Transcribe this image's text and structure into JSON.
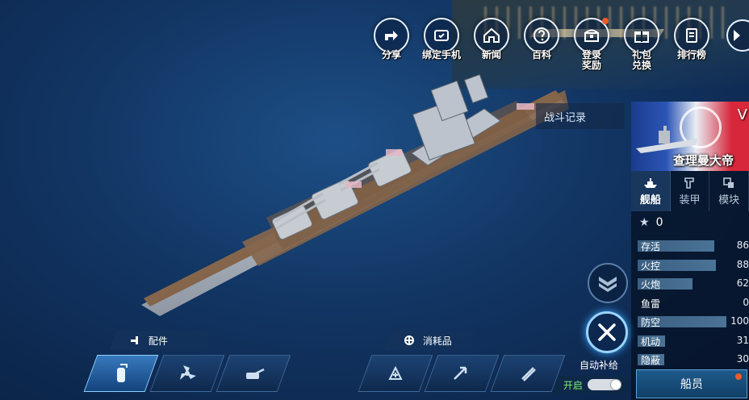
{
  "top_menu": [
    {
      "label": "分享",
      "icon": "share-icon",
      "dot": false
    },
    {
      "label": "绑定手机",
      "icon": "phone-bind-icon",
      "dot": false
    },
    {
      "label": "新闻",
      "icon": "home-icon",
      "dot": false
    },
    {
      "label": "百科",
      "icon": "help-icon",
      "dot": false
    },
    {
      "label": "登录\n奖励",
      "icon": "chest-icon",
      "dot": true
    },
    {
      "label": "礼包\n兑换",
      "icon": "gift-icon",
      "dot": false
    },
    {
      "label": "排行榜",
      "icon": "leaderboard-icon",
      "dot": false
    }
  ],
  "battle_log": "战斗记录",
  "ship": {
    "tier": "V",
    "name": "查理曼大帝"
  },
  "tabs": [
    {
      "label": "舰船",
      "icon": "ship-icon",
      "active": true
    },
    {
      "label": "装甲",
      "icon": "armor-icon",
      "active": false
    },
    {
      "label": "模块",
      "icon": "module-icon",
      "active": false
    }
  ],
  "stars": "0",
  "stats": [
    {
      "name": "存活",
      "value": 86,
      "level": 0.86
    },
    {
      "name": "火控",
      "value": 88,
      "level": 0.88
    },
    {
      "name": "火炮",
      "value": 62,
      "level": 0.62
    },
    {
      "name": "鱼雷",
      "value": 0,
      "level": 0
    },
    {
      "name": "防空",
      "value": 100,
      "level": 1.0
    },
    {
      "name": "机动",
      "value": 31,
      "level": 0.31
    },
    {
      "name": "隐蔽",
      "value": 30,
      "level": 0.3
    }
  ],
  "crew_button": "船员",
  "accessories_label": "配件",
  "consumables_label": "消耗品",
  "auto_supply": {
    "label": "自动补给",
    "state": "开启"
  },
  "colors": {
    "accent": "#8fd0ff",
    "alert": "#f05a28",
    "on": "#7cf06a"
  }
}
